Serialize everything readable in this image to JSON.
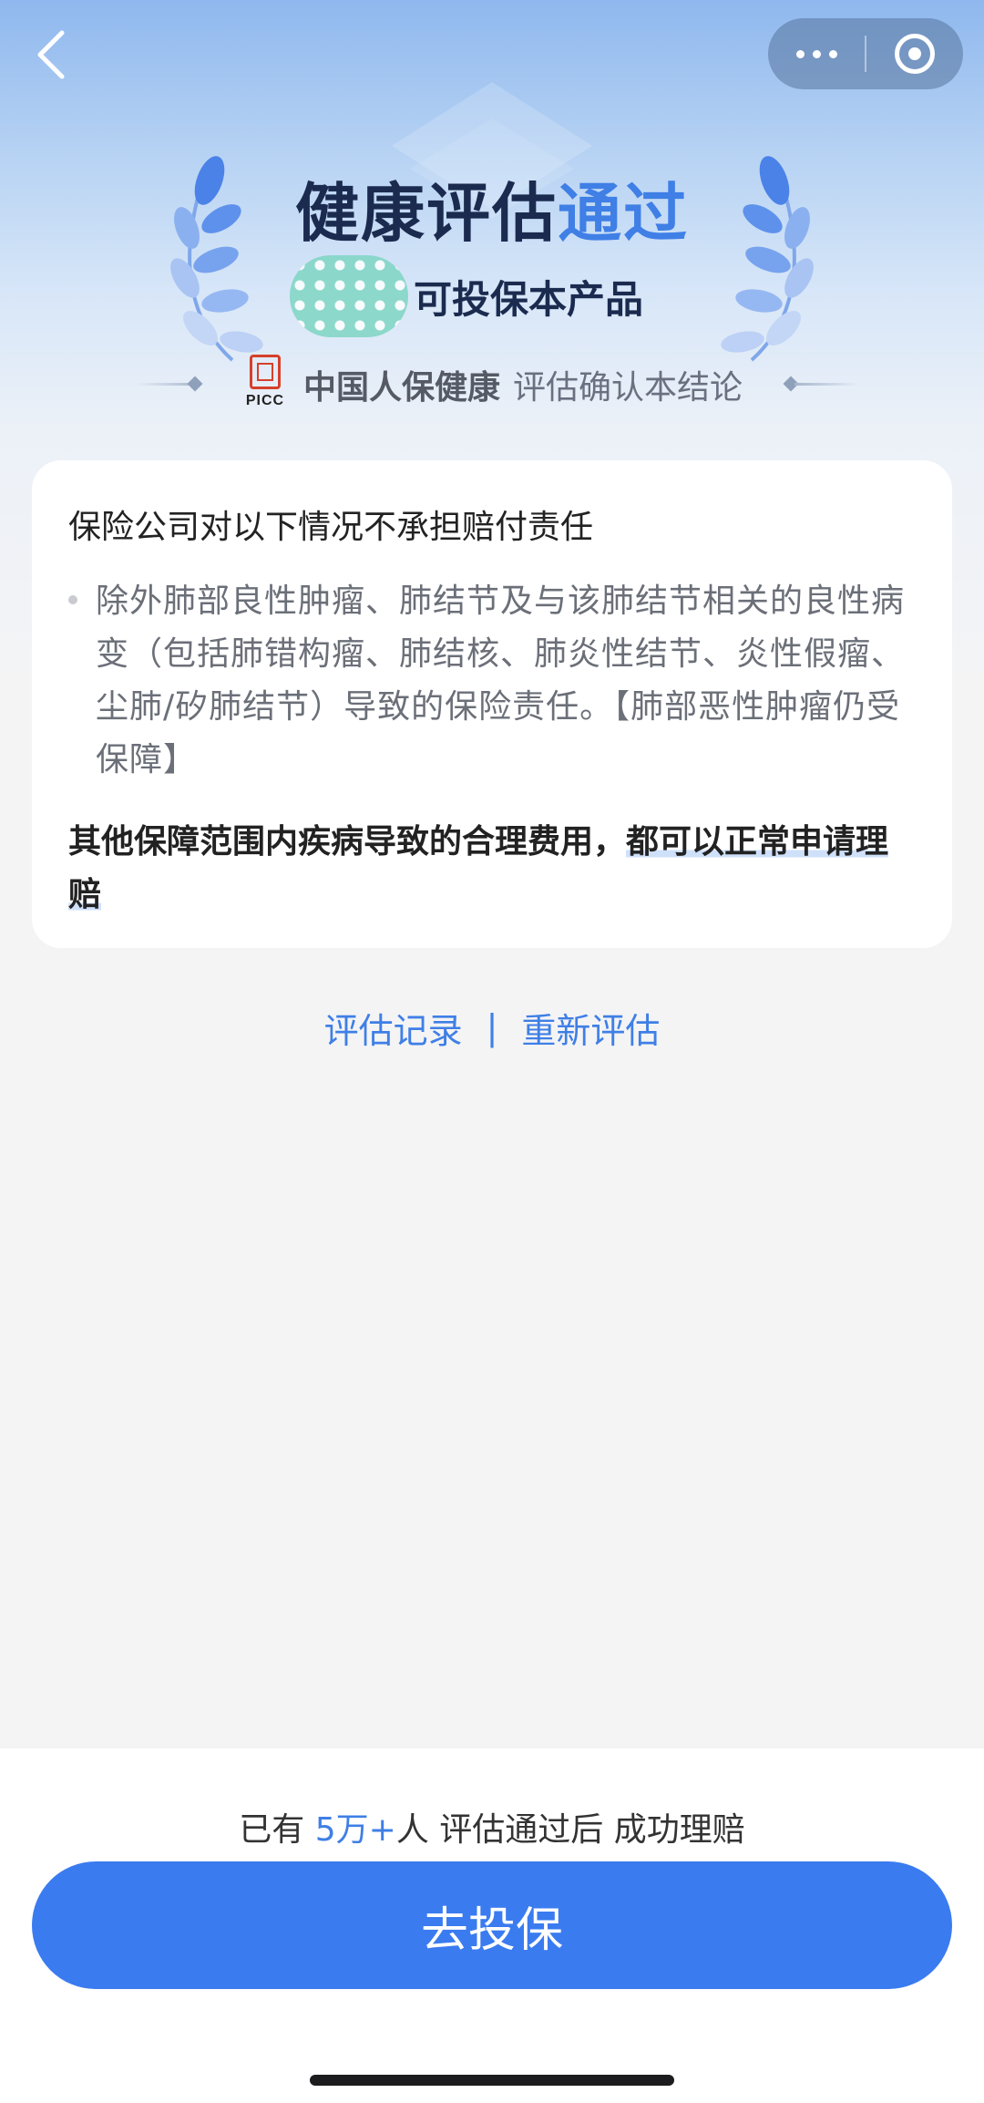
{
  "nav": {
    "back_icon": "chevron-left-icon",
    "more_icon": "more-dots-icon",
    "close_icon": "target-close-icon"
  },
  "header": {
    "title_main": "健康评估",
    "title_highlight": "通过",
    "subtitle": "可投保本产品",
    "company_logo_text": "PICC",
    "company": "中国人保健康",
    "company_suffix": "评估确认本结论"
  },
  "exclusion_card": {
    "title": "保险公司对以下情况不承担赔付责任",
    "items": [
      "除外肺部良性肿瘤、肺结节及与该肺结节相关的良性病变（包括肺错构瘤、肺结核、肺炎性结节、炎性假瘤、尘肺/矽肺结节）导致的保险责任。【肺部恶性肿瘤仍受保障】"
    ],
    "note_part1": "其他保障范围内疾病导致的合理费用，",
    "note_part2": "都可以正常申请理赔"
  },
  "links": {
    "records": "评估记录",
    "separator": "|",
    "reassess": "重新评估"
  },
  "bottom": {
    "claim_prefix": "已有 ",
    "claim_number": "5万+",
    "claim_suffix": "人 评估通过后 成功理赔",
    "cta_label": "去投保"
  },
  "colors": {
    "accent": "#3f7fe6",
    "cta": "#3a7bf0",
    "title": "#1b2b4f",
    "picc_red": "#d6402b"
  }
}
